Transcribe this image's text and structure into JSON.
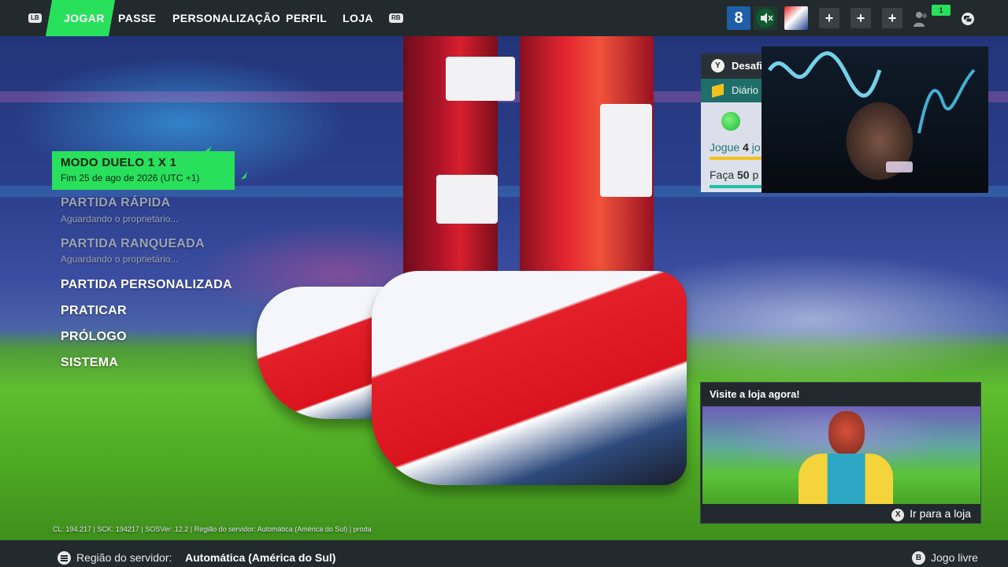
{
  "nav": {
    "left_bumper": "LB",
    "right_bumper": "RB",
    "tabs": [
      {
        "label": "JOGAR",
        "active": true
      },
      {
        "label": "PASSE",
        "active": false
      },
      {
        "label": "PERSONALIZAÇÃO",
        "active": false
      },
      {
        "label": "PERFIL",
        "active": false
      },
      {
        "label": "LOJA",
        "active": false
      }
    ]
  },
  "hud": {
    "player_level": "8",
    "friends_count": "1",
    "party_slots": [
      "+",
      "+",
      "+"
    ]
  },
  "menu": {
    "selected": {
      "title": "MODO DUELO 1 X 1",
      "subtitle": "Fim 25 de ago de 2026 (UTC +1)"
    },
    "items": [
      {
        "label": "PARTIDA RÁPIDA",
        "sub": "Aguardando o proprietário...",
        "disabled": true
      },
      {
        "label": "PARTIDA RANQUEADA",
        "sub": "Aguardando o proprietário...",
        "disabled": true
      },
      {
        "label": "PARTIDA PERSONALIZADA",
        "disabled": false
      },
      {
        "label": "PRATICAR",
        "disabled": false
      },
      {
        "label": "PRÓLOGO",
        "disabled": false
      },
      {
        "label": "SISTEMA",
        "disabled": false
      }
    ]
  },
  "challenges": {
    "button": "Y",
    "title": "Desafi",
    "tab": "Diário",
    "task1": {
      "text_pre": "Jogue ",
      "number": "4",
      "text_post": " jo"
    },
    "task2": {
      "text_pre": "Faça ",
      "number": "50",
      "text_post": " p"
    }
  },
  "shop_card": {
    "title": "Visite a loja agora!",
    "button": "X",
    "action": "Ir para a loja"
  },
  "version_line": "CL: 194.217 | SCK: 194217 | SOSVer: 12.2 | Região do servidor: Automática (América do Sul) | proda",
  "bottom_bar": {
    "region_label": "Região do servidor:",
    "region_value": "Automática (América do Sul)",
    "back_button": "B",
    "back_label": "Jogo livre"
  },
  "colors": {
    "accent": "#29e05c",
    "bar": "#232a2e",
    "level_blue": "#1e5fa8",
    "challenge_teal": "#1f6e6a"
  }
}
